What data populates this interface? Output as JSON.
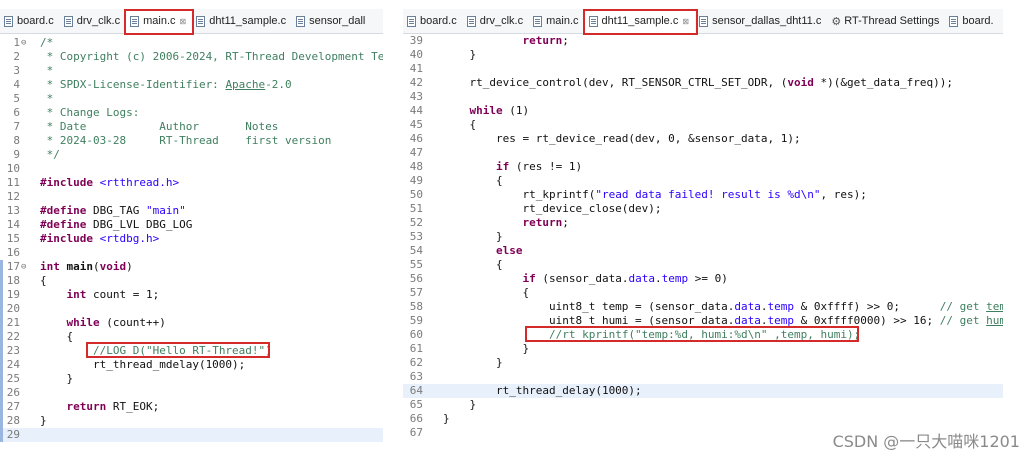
{
  "left": {
    "tabs": [
      {
        "label": "board.c",
        "active": false,
        "close": ""
      },
      {
        "label": "drv_clk.c",
        "active": false,
        "close": ""
      },
      {
        "label": "main.c",
        "active": true,
        "close": "⊠"
      },
      {
        "label": "dht11_sample.c",
        "active": false,
        "close": ""
      },
      {
        "label": "sensor_dall",
        "active": false,
        "close": ""
      }
    ],
    "lines": [
      {
        "n": "1",
        "fold": "⊖",
        "html": "<span class='cm'>/*</span>"
      },
      {
        "n": "2",
        "html": "<span class='cm'> * Copyright (c) 2006-2024, RT-Thread Development Team</span>"
      },
      {
        "n": "3",
        "html": "<span class='cm'> *</span>"
      },
      {
        "n": "4",
        "html": "<span class='cm'> * SPDX-License-Identifier: <u>Apache</u>-2.0</span>"
      },
      {
        "n": "5",
        "html": "<span class='cm'> *</span>"
      },
      {
        "n": "6",
        "html": "<span class='cm'> * Change Logs:</span>"
      },
      {
        "n": "7",
        "html": "<span class='cm'> * Date           Author       Notes</span>"
      },
      {
        "n": "8",
        "html": "<span class='cm'> * 2024-03-28     RT-Thread    first version</span>"
      },
      {
        "n": "9",
        "html": "<span class='cm'> */</span>"
      },
      {
        "n": "10",
        "html": ""
      },
      {
        "n": "11",
        "html": "<span class='kw'>#include</span> <span class='inc'>&lt;rtthread.h&gt;</span>"
      },
      {
        "n": "12",
        "html": ""
      },
      {
        "n": "13",
        "html": "<span class='kw'>#define</span> DBG_TAG <span class='str'>\"main\"</span>"
      },
      {
        "n": "14",
        "html": "<span class='kw'>#define</span> DBG_LVL DBG_LOG"
      },
      {
        "n": "15",
        "html": "<span class='kw'>#include</span> <span class='inc'>&lt;rtdbg.h&gt;</span>"
      },
      {
        "n": "16",
        "html": ""
      },
      {
        "n": "17",
        "fold": "⊖",
        "html": "<span class='kw'>int</span> <b>main</b>(<span class='kw'>void</span>)"
      },
      {
        "n": "18",
        "html": "{"
      },
      {
        "n": "19",
        "html": "    <span class='kw'>int</span> count = 1;"
      },
      {
        "n": "20",
        "html": ""
      },
      {
        "n": "21",
        "html": "    <span class='kw'>while</span> (count++)"
      },
      {
        "n": "22",
        "html": "    {"
      },
      {
        "n": "23",
        "html": "        <span class='cm'>//LOG_D(\"Hello RT-Thread!\")</span>"
      },
      {
        "n": "24",
        "html": "        rt_thread_mdelay(1000);"
      },
      {
        "n": "25",
        "html": "    }"
      },
      {
        "n": "26",
        "html": ""
      },
      {
        "n": "27",
        "html": "    <span class='kw'>return</span> RT_EOK;"
      },
      {
        "n": "28",
        "html": "}"
      },
      {
        "n": "29",
        "html": "",
        "cur": true
      }
    ]
  },
  "right": {
    "tabs": [
      {
        "label": "board.c",
        "active": false,
        "close": ""
      },
      {
        "label": "drv_clk.c",
        "active": false,
        "close": ""
      },
      {
        "label": "main.c",
        "active": false,
        "close": ""
      },
      {
        "label": "dht11_sample.c",
        "active": true,
        "close": "⊠"
      },
      {
        "label": "sensor_dallas_dht11.c",
        "active": false,
        "close": ""
      },
      {
        "label": "RT-Thread Settings",
        "active": false,
        "close": "",
        "gear": true
      },
      {
        "label": "board.",
        "active": false,
        "close": ""
      }
    ],
    "lines": [
      {
        "n": "39",
        "html": "            <span class='kw'>return</span>;"
      },
      {
        "n": "40",
        "html": "    }"
      },
      {
        "n": "41",
        "html": ""
      },
      {
        "n": "42",
        "html": "    rt_device_control(dev, RT_SENSOR_CTRL_SET_ODR, (<span class='kw'>void</span> *)(&amp;get_data_freq));"
      },
      {
        "n": "43",
        "html": ""
      },
      {
        "n": "44",
        "html": "    <span class='kw'>while</span> (1)"
      },
      {
        "n": "45",
        "html": "    {"
      },
      {
        "n": "46",
        "html": "        res = rt_device_read(dev, 0, &amp;sensor_data, 1);"
      },
      {
        "n": "47",
        "html": ""
      },
      {
        "n": "48",
        "html": "        <span class='kw'>if</span> (res != 1)"
      },
      {
        "n": "49",
        "html": "        {"
      },
      {
        "n": "50",
        "html": "            rt_kprintf(<span class='str'>\"read data failed! result is %d\\n\"</span>, res);"
      },
      {
        "n": "51",
        "html": "            rt_device_close(dev);"
      },
      {
        "n": "52",
        "html": "            <span class='kw'>return</span>;"
      },
      {
        "n": "53",
        "html": "        }"
      },
      {
        "n": "54",
        "html": "        <span class='kw'>else</span>"
      },
      {
        "n": "55",
        "html": "        {"
      },
      {
        "n": "56",
        "html": "            <span class='kw'>if</span> (sensor_data.<span class='str'>data</span>.<span class='str'>temp</span> &gt;= 0)"
      },
      {
        "n": "57",
        "html": "            {"
      },
      {
        "n": "58",
        "html": "                uint8_t temp = (sensor_data.<span class='str'>data</span>.<span class='str'>temp</span> &amp; 0xffff) &gt;&gt; 0;      <span class='cm'>// get <u>temp</u></span>"
      },
      {
        "n": "59",
        "html": "                uint8_t humi = (sensor_data.<span class='str'>data</span>.<span class='str'>temp</span> &amp; 0xffff0000) &gt;&gt; 16; <span class='cm'>// get <u>humi</u></span>"
      },
      {
        "n": "60",
        "html": "                <span class='cm'>//rt_kprintf(\"temp:%d, humi:%d\\n\" ,temp, humi);</span>"
      },
      {
        "n": "61",
        "html": "            }"
      },
      {
        "n": "62",
        "html": "        }"
      },
      {
        "n": "63",
        "html": ""
      },
      {
        "n": "64",
        "html": "        rt_thread_delay(1000);",
        "cur": true
      },
      {
        "n": "65",
        "html": "    }"
      },
      {
        "n": "66",
        "html": "}"
      },
      {
        "n": "67",
        "html": ""
      }
    ]
  },
  "watermark": "CSDN @一只大喵咪1201"
}
